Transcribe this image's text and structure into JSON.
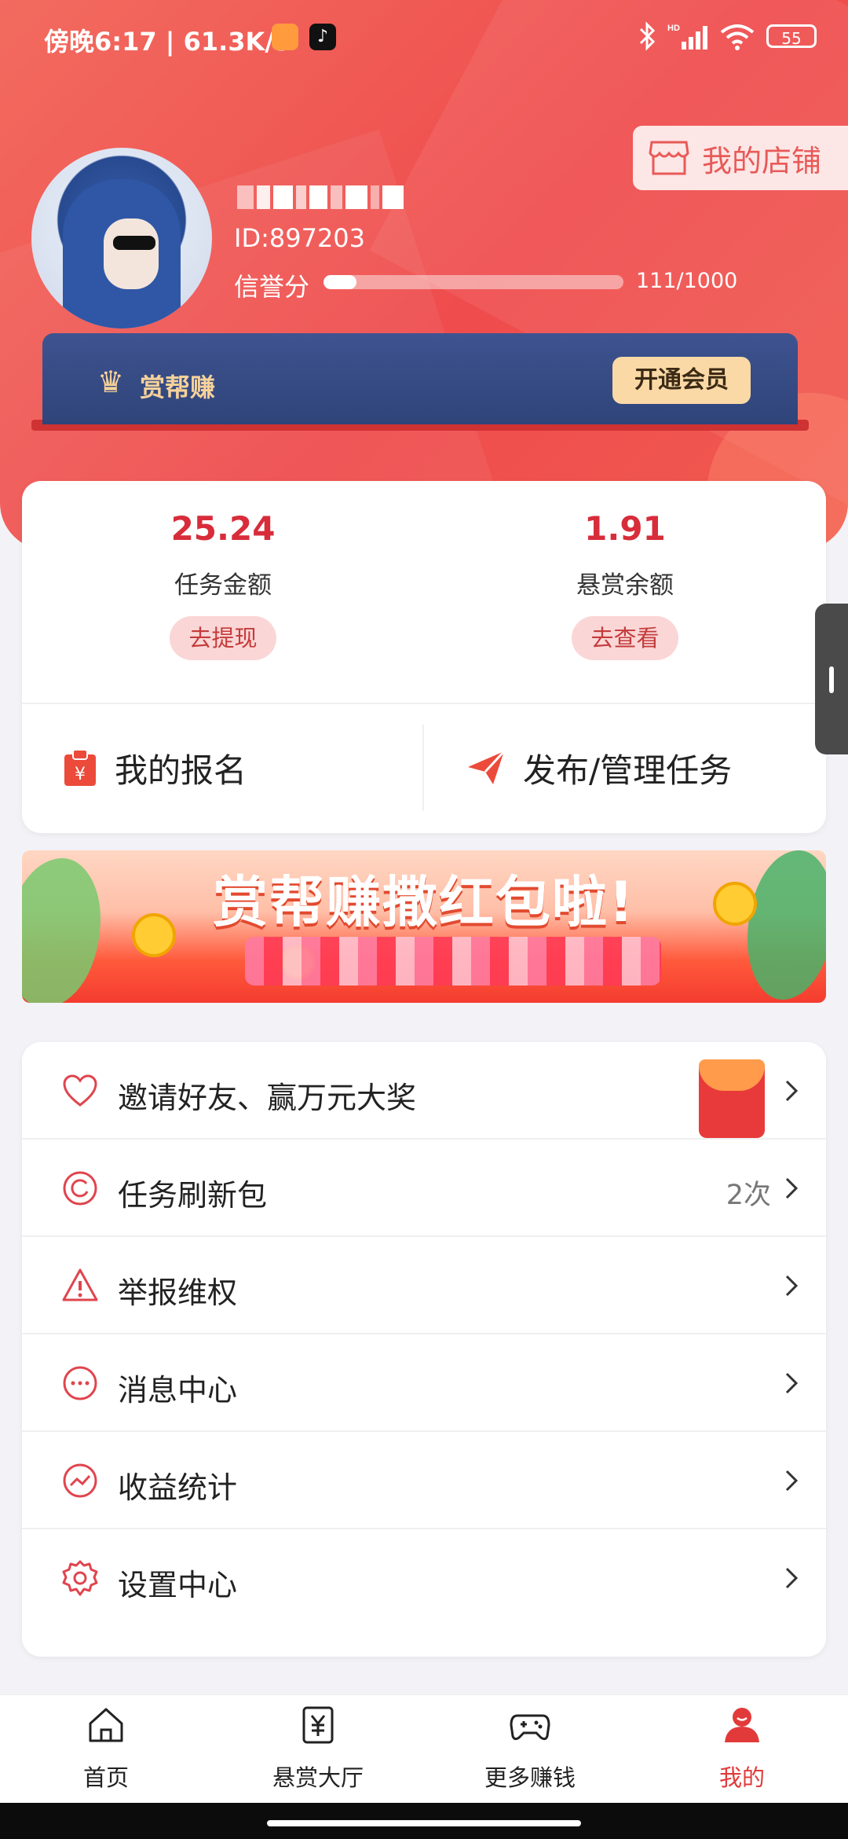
{
  "status_bar": {
    "time_speed": "傍晚6:17 | 61.3K/s",
    "battery": "55",
    "app_icons": [
      "shopping-bag-icon",
      "tiktok-icon"
    ],
    "system_icons": [
      "bluetooth-icon",
      "signal-hd-icon",
      "wifi-icon",
      "battery-icon"
    ]
  },
  "profile": {
    "id": "ID:897203",
    "credit_label": "信誉分",
    "credit_value": "111/1000",
    "credit_progress": 0.111,
    "shop_button": "我的店铺"
  },
  "vip": {
    "title": "赏帮赚",
    "button": "开通会员"
  },
  "stats": {
    "task_amount": "25.24",
    "task_amount_label": "任务金额",
    "withdraw_button": "去提现",
    "reward_balance": "1.91",
    "reward_balance_label": "悬赏余额",
    "view_button": "去查看"
  },
  "actions": {
    "my_signup": "我的报名",
    "publish_manage": "发布/管理任务"
  },
  "banner": {
    "title": "赏帮赚撒红包啦!"
  },
  "menu": {
    "items": [
      {
        "label": "邀请好友、赢万元大奖",
        "extra": ""
      },
      {
        "label": "任务刷新包",
        "extra": "2次"
      },
      {
        "label": "举报维权",
        "extra": ""
      },
      {
        "label": "消息中心",
        "extra": ""
      },
      {
        "label": "收益统计",
        "extra": ""
      },
      {
        "label": "设置中心",
        "extra": ""
      }
    ]
  },
  "bottom_nav": {
    "tabs": [
      {
        "label": "首页"
      },
      {
        "label": "悬赏大厅"
      },
      {
        "label": "更多赚钱"
      },
      {
        "label": "我的"
      }
    ]
  },
  "colors": {
    "brand_red": "#ef4c4d",
    "accent_red_text": "#d82c3a",
    "vip_navy": "#2f4479",
    "vip_gold": "#fbd9a6"
  }
}
